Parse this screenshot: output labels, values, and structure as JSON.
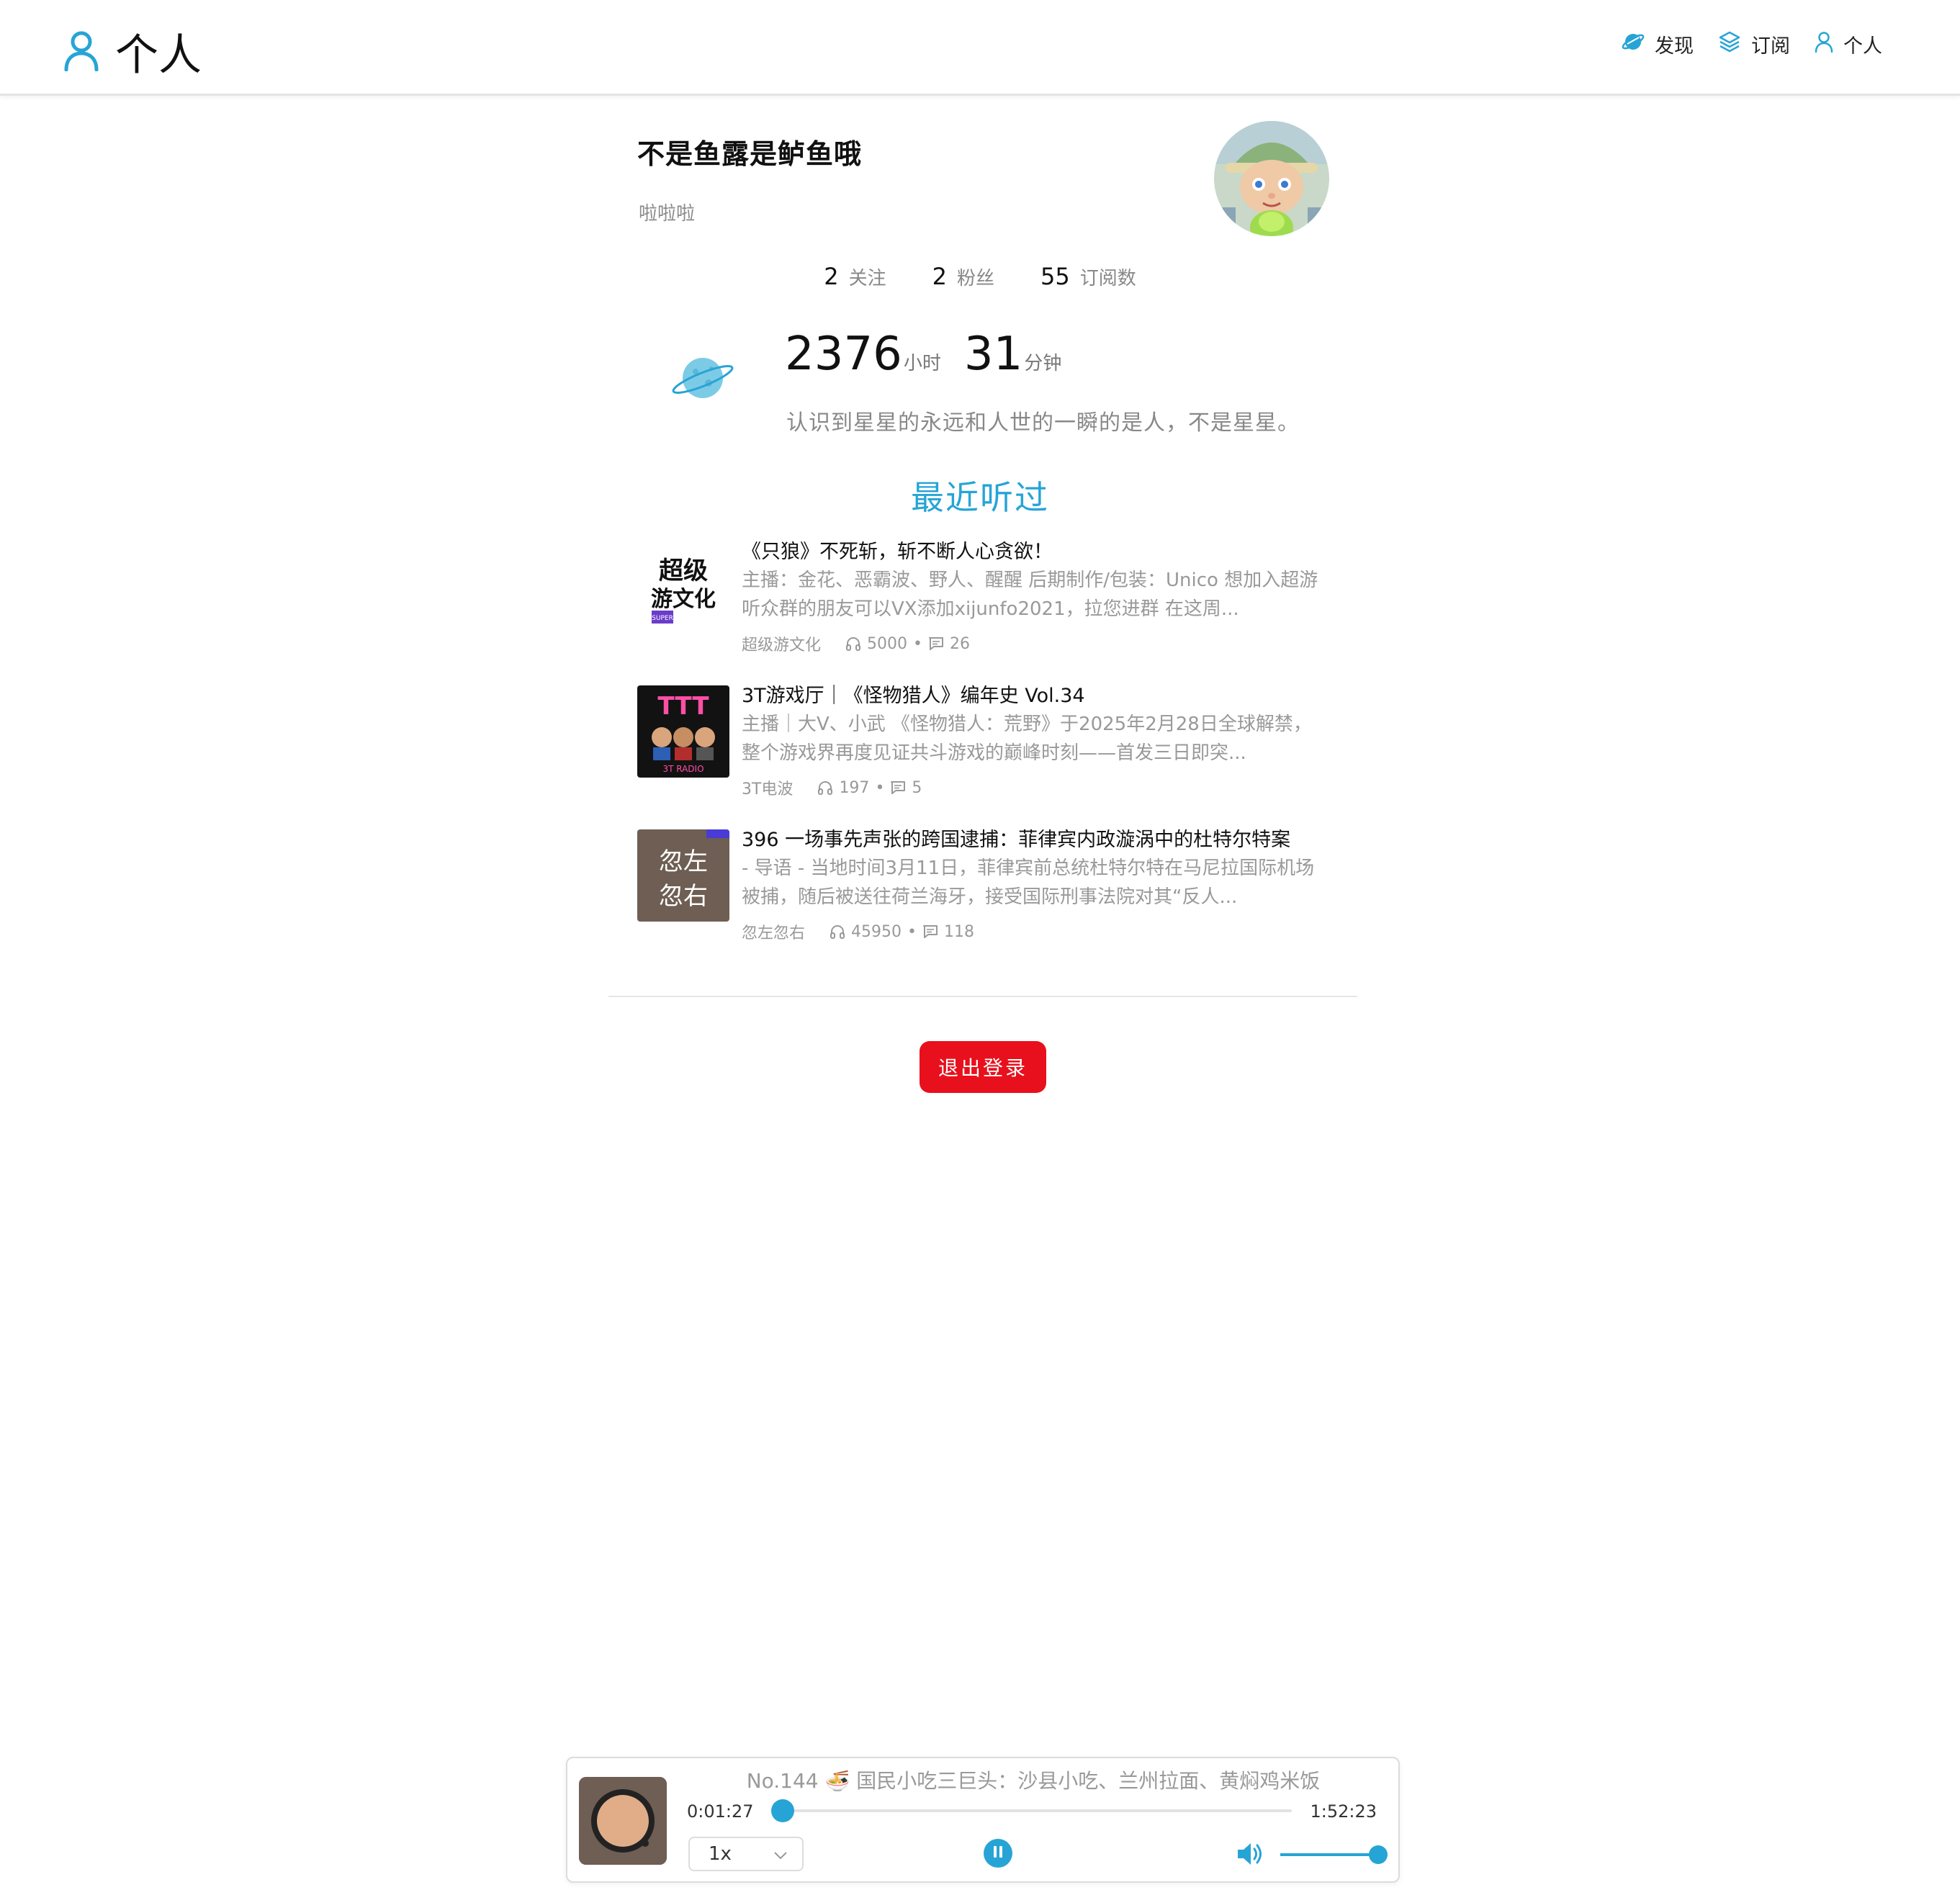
{
  "header": {
    "title": "个人",
    "nav": [
      {
        "label": "发现",
        "icon": "planet-icon"
      },
      {
        "label": "订阅",
        "icon": "layers-icon"
      },
      {
        "label": "个人",
        "icon": "user-icon"
      }
    ]
  },
  "profile": {
    "name": "不是鱼露是鲈鱼哦",
    "bio": "啦啦啦",
    "stats": [
      {
        "value": "2",
        "label": "关注"
      },
      {
        "value": "2",
        "label": "粉丝"
      },
      {
        "value": "55",
        "label": "订阅数"
      }
    ],
    "listen_time": {
      "hours": "2376",
      "hours_unit": "小时",
      "minutes": "31",
      "minutes_unit": "分钟"
    },
    "quote": "认识到星星的永远和人世的一瞬的是人，不是星星。"
  },
  "recent": {
    "title": "最近听过",
    "episodes": [
      {
        "title": "《只狼》不死斩，斩不断人心贪欲！",
        "description": "主播：金花、恶霸波、野人、醒醒 后期制作/包装：Unico 想加入超游听众群的朋友可以VX添加xijunfo2021，拉您进群 在这周...",
        "podcast": "超级游文化",
        "plays": "5000",
        "comments": "26",
        "cover_text": "超级游文化"
      },
      {
        "title": "3T游戏厅｜《怪物猎人》编年史 Vol.34",
        "description": "主播｜大V、小武 《怪物猎人：荒野》于2025年2月28日全球解禁，整个游戏界再度见证共斗游戏的巅峰时刻——首发三日即突...",
        "podcast": "3T电波",
        "plays": "197",
        "comments": "5",
        "cover_text": "3T RADIO"
      },
      {
        "title": "396 一场事先声张的跨国逮捕：菲律宾内政漩涡中的杜特尔特案",
        "description": "- 导语 - 当地时间3月11日，菲律宾前总统杜特尔特在马尼拉国际机场被捕，随后被送往荷兰海牙，接受国际刑事法院对其“反人...",
        "podcast": "忽左忽右",
        "plays": "45950",
        "comments": "118",
        "cover_text": "忽左忽右"
      }
    ]
  },
  "logout_label": "退出登录",
  "player": {
    "title": "No.144 🍜 国民小吃三巨头：沙县小吃、兰州拉面、黄焖鸡米饭",
    "current_time": "0:01:27",
    "total_time": "1:52:23",
    "progress": 0.013,
    "speed": "1x",
    "volume": 1.0,
    "state": "playing"
  },
  "colors": {
    "accent": "#27a4d6",
    "logout": "#e8101c"
  }
}
